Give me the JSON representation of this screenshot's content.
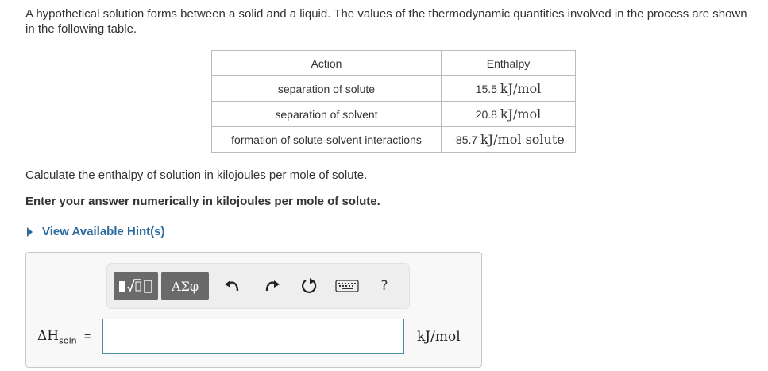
{
  "intro": "A hypothetical solution forms between a solid and a liquid.  The values of the thermodynamic quantities involved in the process are shown in the following table.",
  "table": {
    "headers": [
      "Action",
      "Enthalpy"
    ],
    "rows": [
      {
        "action": "separation of solute",
        "value": "15.5",
        "unit": "kJ/mol"
      },
      {
        "action": "separation of solvent",
        "value": "20.8",
        "unit": "kJ/mol"
      },
      {
        "action": "formation of solute-solvent interactions",
        "value": "-85.7",
        "unit": "kJ/mol solute"
      }
    ]
  },
  "question": "Calculate the enthalpy of solution in kilojoules per mole of solute.",
  "instruction": "Enter your answer numerically in kilojoules per mole of solute.",
  "hint_link": "View Available Hint(s)",
  "toolbar": {
    "greek_label": "ΑΣφ",
    "help_label": "?",
    "icons": [
      "templates-icon",
      "greek-letters-icon",
      "undo-icon",
      "redo-icon",
      "reset-icon",
      "keyboard-icon",
      "help-icon"
    ]
  },
  "answer": {
    "label_main": "ΔH",
    "label_sub": "soln",
    "label_eq": "=",
    "value": "",
    "unit": "kJ/mol"
  },
  "colors": {
    "link": "#2a6a9e",
    "input_border": "#4a90a4",
    "toolbar_button": "#6a6a6a"
  }
}
